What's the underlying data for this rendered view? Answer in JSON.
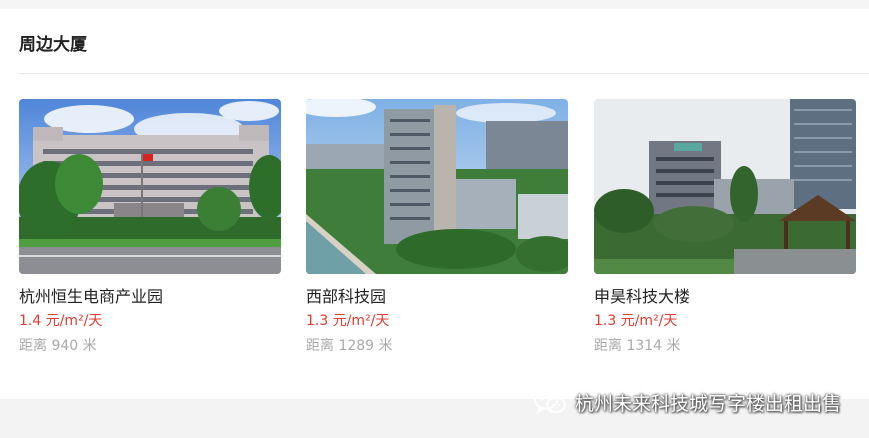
{
  "section": {
    "title": "周边大厦"
  },
  "buildings": [
    {
      "name": "杭州恒生电商产业园",
      "price": "1.4 元/m²/天",
      "distance": "距离 940 米"
    },
    {
      "name": "西部科技园",
      "price": "1.3 元/m²/天",
      "distance": "距离 1289 米"
    },
    {
      "name": "申昊科技大楼",
      "price": "1.3 元/m²/天",
      "distance": "距离 1314 米"
    }
  ],
  "watermark": {
    "text": "杭州未来科技城写字楼出租出售",
    "icon": "wechat-icon"
  },
  "colors": {
    "price": "#e03c31",
    "muted": "#aaaaaa",
    "title": "#222222"
  }
}
